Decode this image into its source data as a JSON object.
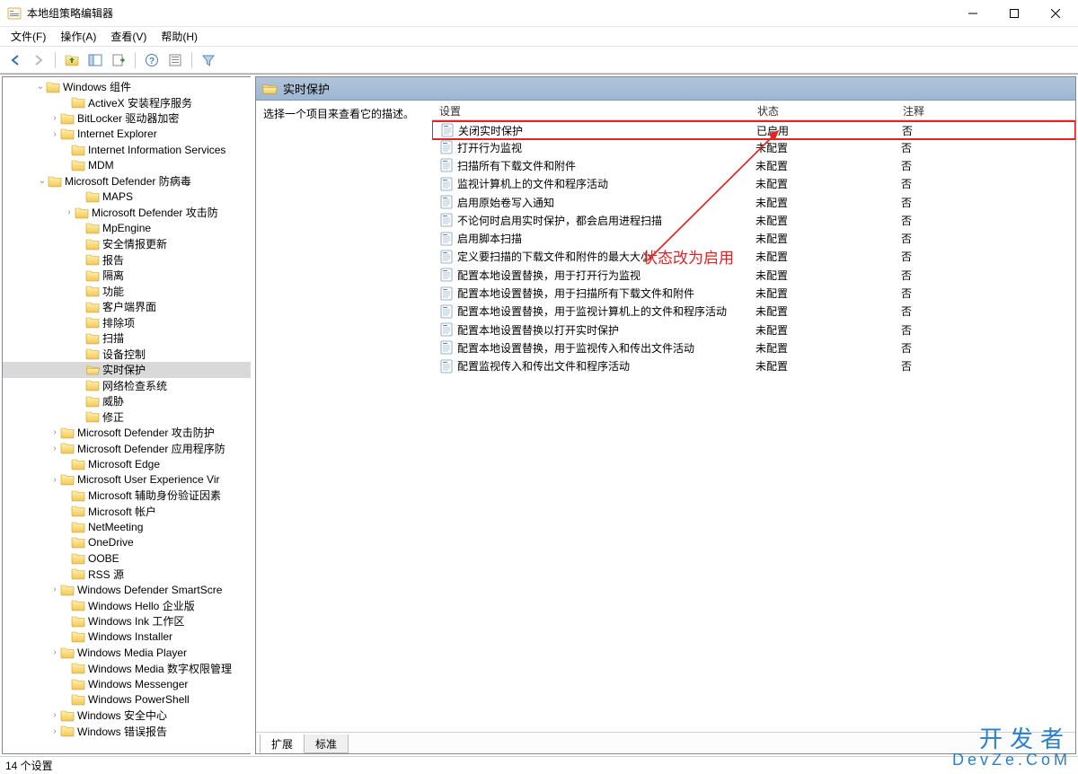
{
  "window": {
    "title": "本地组策略编辑器"
  },
  "menu": {
    "file": "文件(F)",
    "action": "操作(A)",
    "view": "查看(V)",
    "help": "帮助(H)"
  },
  "toolbar_icons": {
    "back": "back-icon",
    "forward": "forward-icon",
    "up": "up-icon",
    "show": "show-icon",
    "refresh": "refresh-icon",
    "export": "export-icon",
    "help": "help-icon",
    "prop": "properties-icon",
    "filter": "filter-icon"
  },
  "tree": {
    "sections": [
      {
        "label": "Windows 组件",
        "indent": 48,
        "exp": "v"
      },
      {
        "label": "ActiveX 安装程序服务",
        "indent": 76
      },
      {
        "label": "BitLocker 驱动器加密",
        "indent": 64,
        "exp": ">"
      },
      {
        "label": "Internet Explorer",
        "indent": 64,
        "exp": ">"
      },
      {
        "label": "Internet Information Services",
        "indent": 76
      },
      {
        "label": "MDM",
        "indent": 76
      },
      {
        "label": "Microsoft Defender 防病毒",
        "indent": 50,
        "exp": "v"
      },
      {
        "label": "MAPS",
        "indent": 92
      },
      {
        "label": "Microsoft Defender 攻击防",
        "indent": 80,
        "exp": ">"
      },
      {
        "label": "MpEngine",
        "indent": 92
      },
      {
        "label": "安全情报更新",
        "indent": 92
      },
      {
        "label": "报告",
        "indent": 92
      },
      {
        "label": "隔离",
        "indent": 92
      },
      {
        "label": "功能",
        "indent": 92
      },
      {
        "label": "客户端界面",
        "indent": 92
      },
      {
        "label": "排除项",
        "indent": 92
      },
      {
        "label": "扫描",
        "indent": 92
      },
      {
        "label": "设备控制",
        "indent": 92
      },
      {
        "label": "实时保护",
        "indent": 92,
        "exp": "",
        "selected": true
      },
      {
        "label": "网络检查系统",
        "indent": 92
      },
      {
        "label": "威胁",
        "indent": 92
      },
      {
        "label": "修正",
        "indent": 92
      },
      {
        "label": "Microsoft Defender 攻击防护",
        "indent": 64,
        "exp": ">"
      },
      {
        "label": "Microsoft Defender 应用程序防",
        "indent": 64,
        "exp": ">"
      },
      {
        "label": "Microsoft Edge",
        "indent": 76
      },
      {
        "label": "Microsoft User Experience Vir",
        "indent": 64,
        "exp": ">"
      },
      {
        "label": "Microsoft 辅助身份验证因素",
        "indent": 76
      },
      {
        "label": "Microsoft 帐户",
        "indent": 76
      },
      {
        "label": "NetMeeting",
        "indent": 76
      },
      {
        "label": "OneDrive",
        "indent": 76
      },
      {
        "label": "OOBE",
        "indent": 76
      },
      {
        "label": "RSS 源",
        "indent": 76
      },
      {
        "label": "Windows Defender SmartScre",
        "indent": 64,
        "exp": ">"
      },
      {
        "label": "Windows Hello 企业版",
        "indent": 76
      },
      {
        "label": "Windows Ink 工作区",
        "indent": 76
      },
      {
        "label": "Windows Installer",
        "indent": 76
      },
      {
        "label": "Windows Media Player",
        "indent": 64,
        "exp": ">"
      },
      {
        "label": "Windows Media 数字权限管理",
        "indent": 76
      },
      {
        "label": "Windows Messenger",
        "indent": 76
      },
      {
        "label": "Windows PowerShell",
        "indent": 76
      },
      {
        "label": "Windows 安全中心",
        "indent": 64,
        "exp": ">"
      },
      {
        "label": "Windows 错误报告",
        "indent": 64,
        "exp": ">"
      }
    ]
  },
  "header": {
    "title": "实时保护"
  },
  "help_text": "选择一个项目来查看它的描述。",
  "columns": {
    "setting": "设置",
    "state": "状态",
    "comment": "注释"
  },
  "rows": [
    {
      "name": "关闭实时保护",
      "state": "已启用",
      "comment": "否",
      "highlight": true
    },
    {
      "name": "打开行为监视",
      "state": "未配置",
      "comment": "否"
    },
    {
      "name": "扫描所有下载文件和附件",
      "state": "未配置",
      "comment": "否"
    },
    {
      "name": "监视计算机上的文件和程序活动",
      "state": "未配置",
      "comment": "否"
    },
    {
      "name": "启用原始卷写入通知",
      "state": "未配置",
      "comment": "否"
    },
    {
      "name": "不论何时启用实时保护，都会启用进程扫描",
      "state": "未配置",
      "comment": "否"
    },
    {
      "name": "启用脚本扫描",
      "state": "未配置",
      "comment": "否"
    },
    {
      "name": "定义要扫描的下载文件和附件的最大大小",
      "state": "未配置",
      "comment": "否"
    },
    {
      "name": "配置本地设置替换，用于打开行为监视",
      "state": "未配置",
      "comment": "否"
    },
    {
      "name": "配置本地设置替换，用于扫描所有下载文件和附件",
      "state": "未配置",
      "comment": "否"
    },
    {
      "name": "配置本地设置替换，用于监视计算机上的文件和程序活动",
      "state": "未配置",
      "comment": "否"
    },
    {
      "name": "配置本地设置替换以打开实时保护",
      "state": "未配置",
      "comment": "否"
    },
    {
      "name": "配置本地设置替换，用于监视传入和传出文件活动",
      "state": "未配置",
      "comment": "否"
    },
    {
      "name": "配置监视传入和传出文件和程序活动",
      "state": "未配置",
      "comment": "否"
    }
  ],
  "annotation_text": "状态改为启用",
  "tabs": {
    "extended": "扩展",
    "standard": "标准"
  },
  "statusbar": {
    "text": "14 个设置"
  },
  "watermark": {
    "cn": "开发者",
    "en": "DevZe.CoM"
  }
}
